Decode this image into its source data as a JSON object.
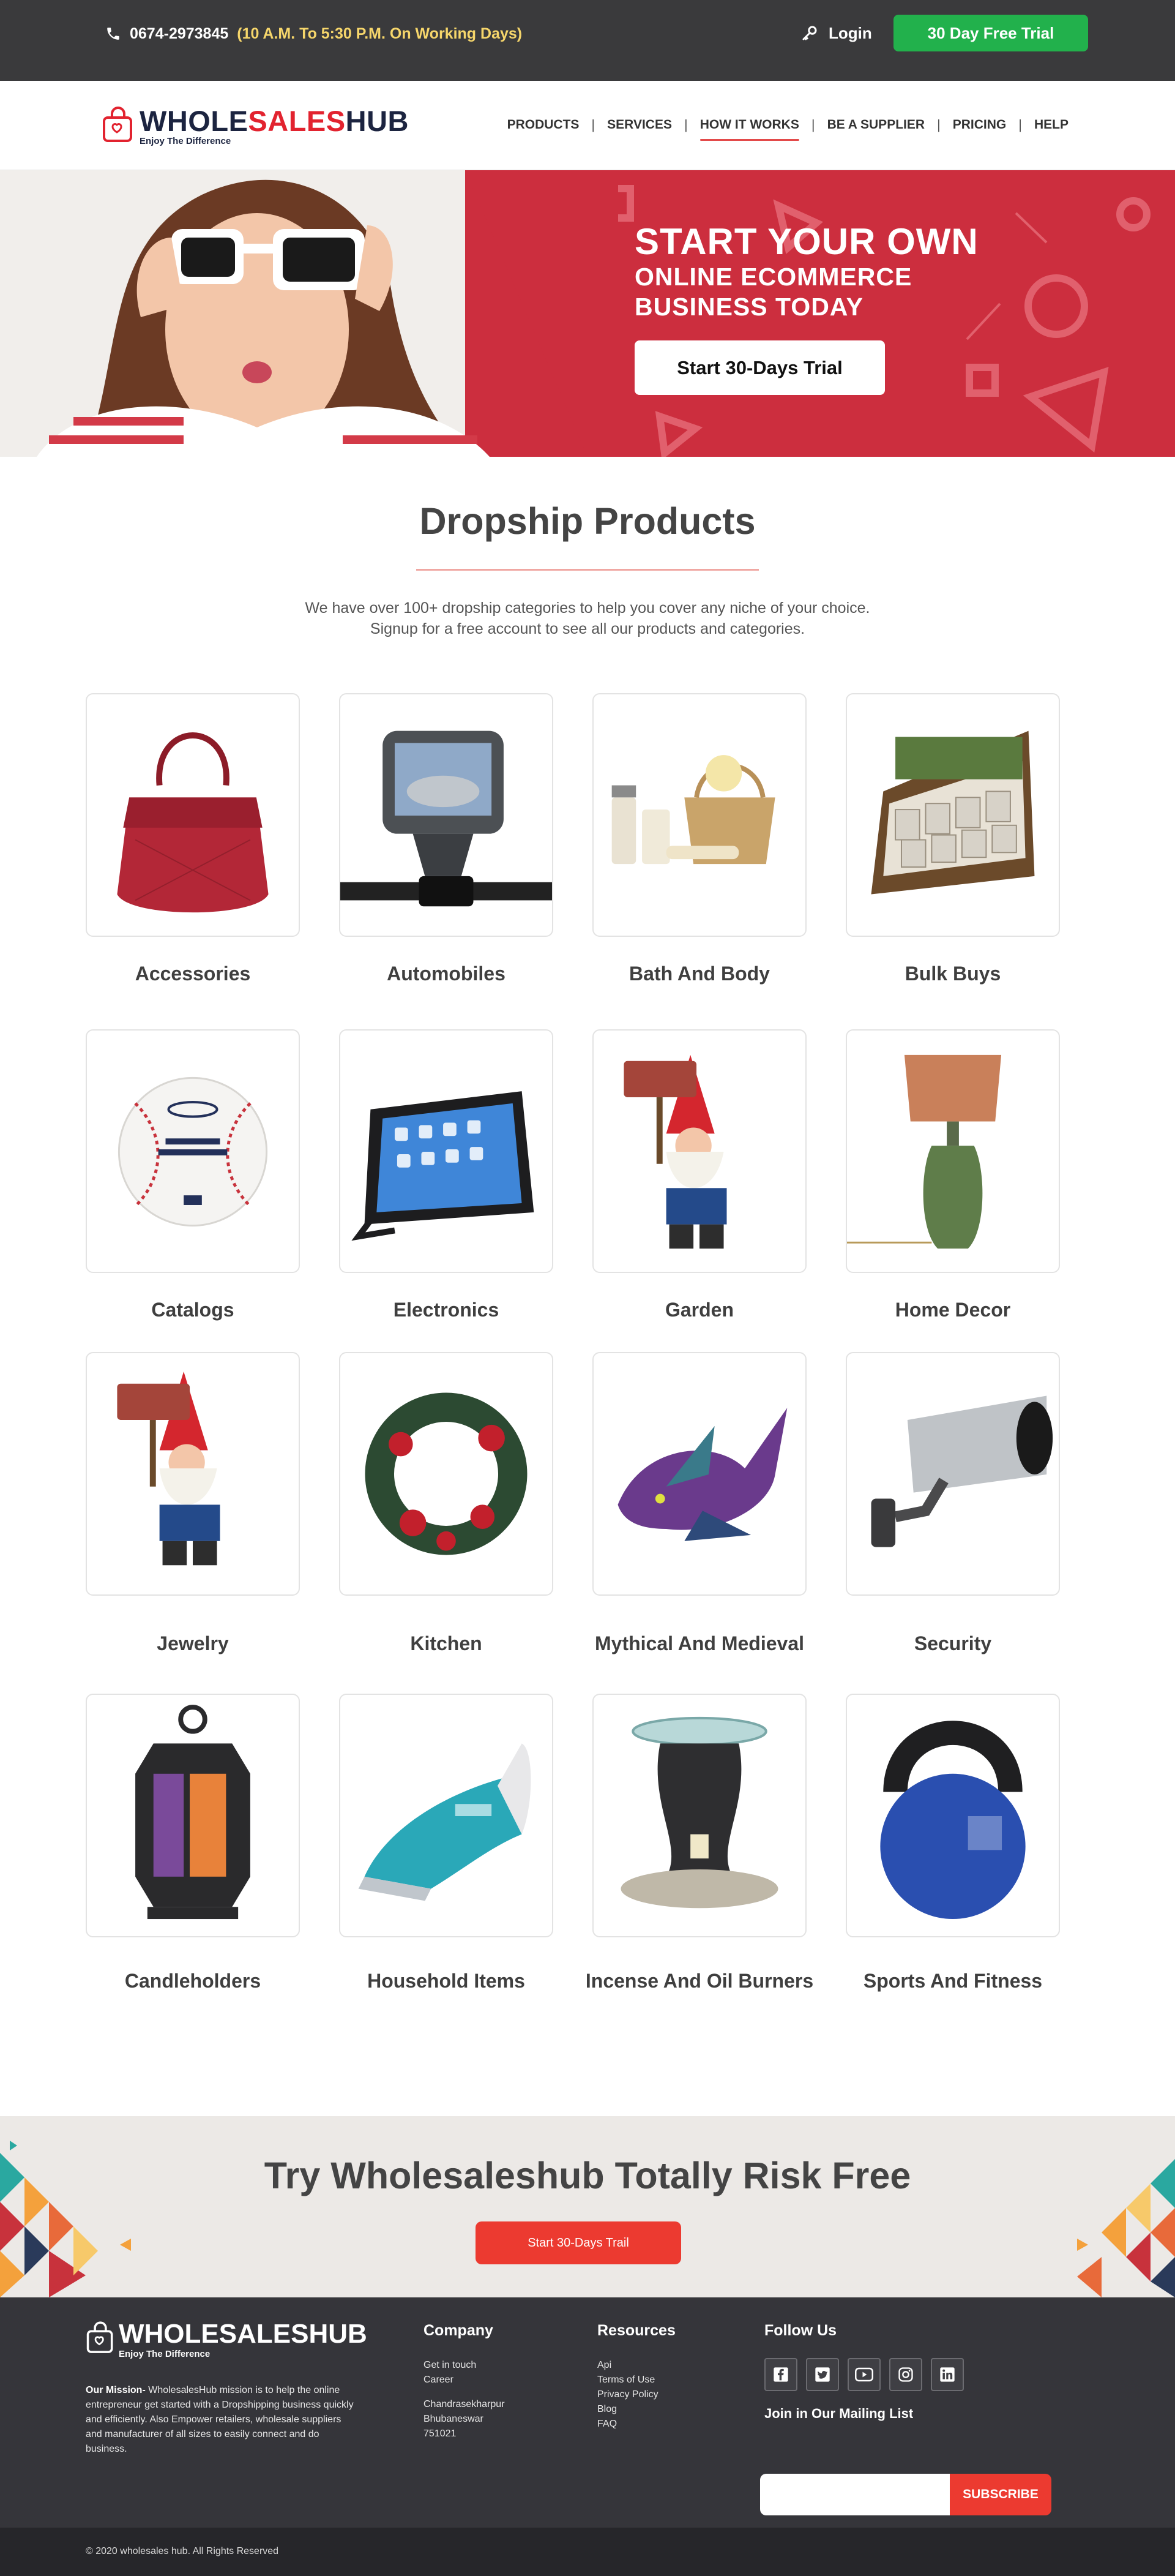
{
  "topbar": {
    "phone": "0674-2973845",
    "hours": "(10 A.M. To 5:30 P.M. On Working Days)",
    "login_label": "Login",
    "trial_label": "30 Day Free Trial",
    "icons": [
      "phone-icon",
      "key-icon"
    ]
  },
  "header": {
    "logo_part1": "WHOLE",
    "logo_part2": "SALES",
    "logo_part3": "HUB",
    "logo_tagline": "Enjoy The Difference",
    "nav": [
      {
        "label": "PRODUCTS"
      },
      {
        "label": "SERVICES"
      },
      {
        "label": "HOW IT WORKS",
        "active": true
      },
      {
        "label": "BE A SUPPLIER"
      },
      {
        "label": "PRICING"
      },
      {
        "label": "HELP"
      }
    ]
  },
  "hero": {
    "line1": "START YOUR OWN",
    "line2": "ONLINE ECOMMERCE",
    "line3": "BUSINESS TODAY",
    "cta_label": "Start 30-Days Trial"
  },
  "products": {
    "title": "Dropship Products",
    "intro_line1": "We have over 100+ dropship categories to help you cover any niche of your choice.",
    "intro_line2": "Signup for a free account to see all our products and categories.",
    "categories": [
      {
        "name": "Accessories",
        "image": "red-handbag"
      },
      {
        "name": "Automobiles",
        "image": "backup-camera-monitor"
      },
      {
        "name": "Bath And Body",
        "image": "bath-gift-basket"
      },
      {
        "name": "Bulk Buys",
        "image": "display-box"
      },
      {
        "name": "Catalogs",
        "image": "baseball"
      },
      {
        "name": "Electronics",
        "image": "tablet-with-stand"
      },
      {
        "name": "Garden",
        "image": "garden-gnome"
      },
      {
        "name": "Home Decor",
        "image": "table-lamp"
      },
      {
        "name": "Jewelry",
        "image": "garden-gnome"
      },
      {
        "name": "Kitchen",
        "image": "christmas-wreath"
      },
      {
        "name": "Mythical And Medieval",
        "image": "dragon-figurine"
      },
      {
        "name": "Security",
        "image": "security-camera"
      },
      {
        "name": "Candleholders",
        "image": "lantern"
      },
      {
        "name": "Household Items",
        "image": "steam-iron"
      },
      {
        "name": "Incense And Oil Burners",
        "image": "oil-burner"
      },
      {
        "name": "Sports And Fitness",
        "image": "kettlebell"
      }
    ]
  },
  "risk": {
    "title": "Try Wholesaleshub Totally Risk Free",
    "cta_label": "Start 30-Days Trail"
  },
  "footer": {
    "logo": "WHOLESALESHUB",
    "logo_tagline": "Enjoy The Difference",
    "mission_label": "Our Mission-",
    "mission_text": " WholesalesHub mission is to help the online entrepreneur get started with a Dropshipping business quickly and efficiently. Also Empower retailers, wholesale suppliers and manufacturer of all sizes to easily connect and do business.",
    "company_title": "Company",
    "company_links": [
      "Get in touch",
      "Career"
    ],
    "address": [
      "Chandrasekharpur",
      "Bhubaneswar",
      "751021"
    ],
    "resources_title": "Resources",
    "resources_links": [
      "Api",
      "Terms of Use",
      "Privacy Policy",
      "Blog",
      "FAQ"
    ],
    "follow_title": "Follow Us",
    "social_icons": [
      "facebook-icon",
      "twitter-icon",
      "youtube-icon",
      "instagram-icon",
      "linkedin-icon"
    ],
    "mailing_label": "Join in Our Mailing List",
    "subscribe_label": "SUBSCRIBE",
    "copyright": "© 2020 wholesales hub. All Rights Reserved"
  },
  "colors": {
    "topbar_bg": "#3a3a3c",
    "trial_green": "#22b14c",
    "hero_red": "#cc2e3e",
    "accent_red": "#ec3a30",
    "footer_bg": "#35353a"
  }
}
